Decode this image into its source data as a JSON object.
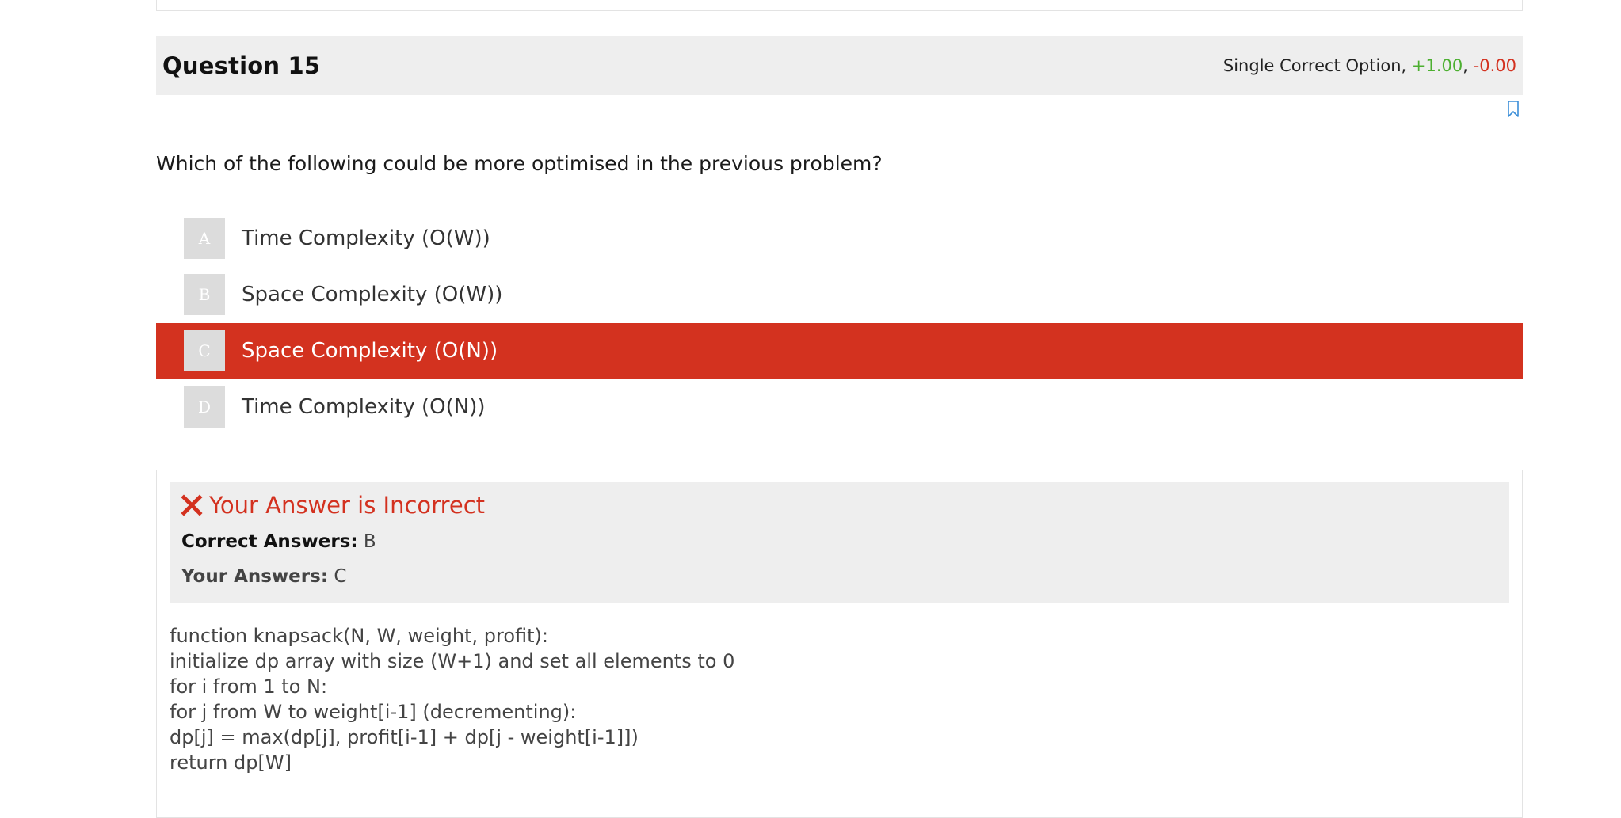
{
  "question": {
    "title": "Question 15",
    "type_label": "Single Correct Option",
    "separator": ",",
    "positive_marks": "+1.00",
    "negative_marks": "-0.00",
    "text": "Which of the following could be more optimised in the previous problem?"
  },
  "options": [
    {
      "letter": "A",
      "label": "Time Complexity (O(W))"
    },
    {
      "letter": "B",
      "label": "Space Complexity (O(W))"
    },
    {
      "letter": "C",
      "label": "Space Complexity (O(N))"
    },
    {
      "letter": "D",
      "label": "Time Complexity (O(N))"
    }
  ],
  "selected_option": "C",
  "result": {
    "verdict": "Your Answer is Incorrect",
    "correct_label": "Correct Answers:",
    "correct_value": "B",
    "your_label": "Your Answers:",
    "your_value": "C"
  },
  "explanation": [
    "function knapsack(N, W, weight, profit):",
    "initialize dp array with size (W+1) and set all elements to 0",
    "",
    "for i from 1 to N:",
    "for j from W to weight[i-1] (decrementing):",
    "dp[j] = max(dp[j], profit[i-1] + dp[j - weight[i-1]])",
    "return dp[W]"
  ],
  "colors": {
    "accent_red": "#d3321f",
    "positive_green": "#4caf30",
    "header_bg": "#eeeeee"
  },
  "icons": {
    "bookmark": "bookmark-icon",
    "incorrect": "close-icon"
  }
}
